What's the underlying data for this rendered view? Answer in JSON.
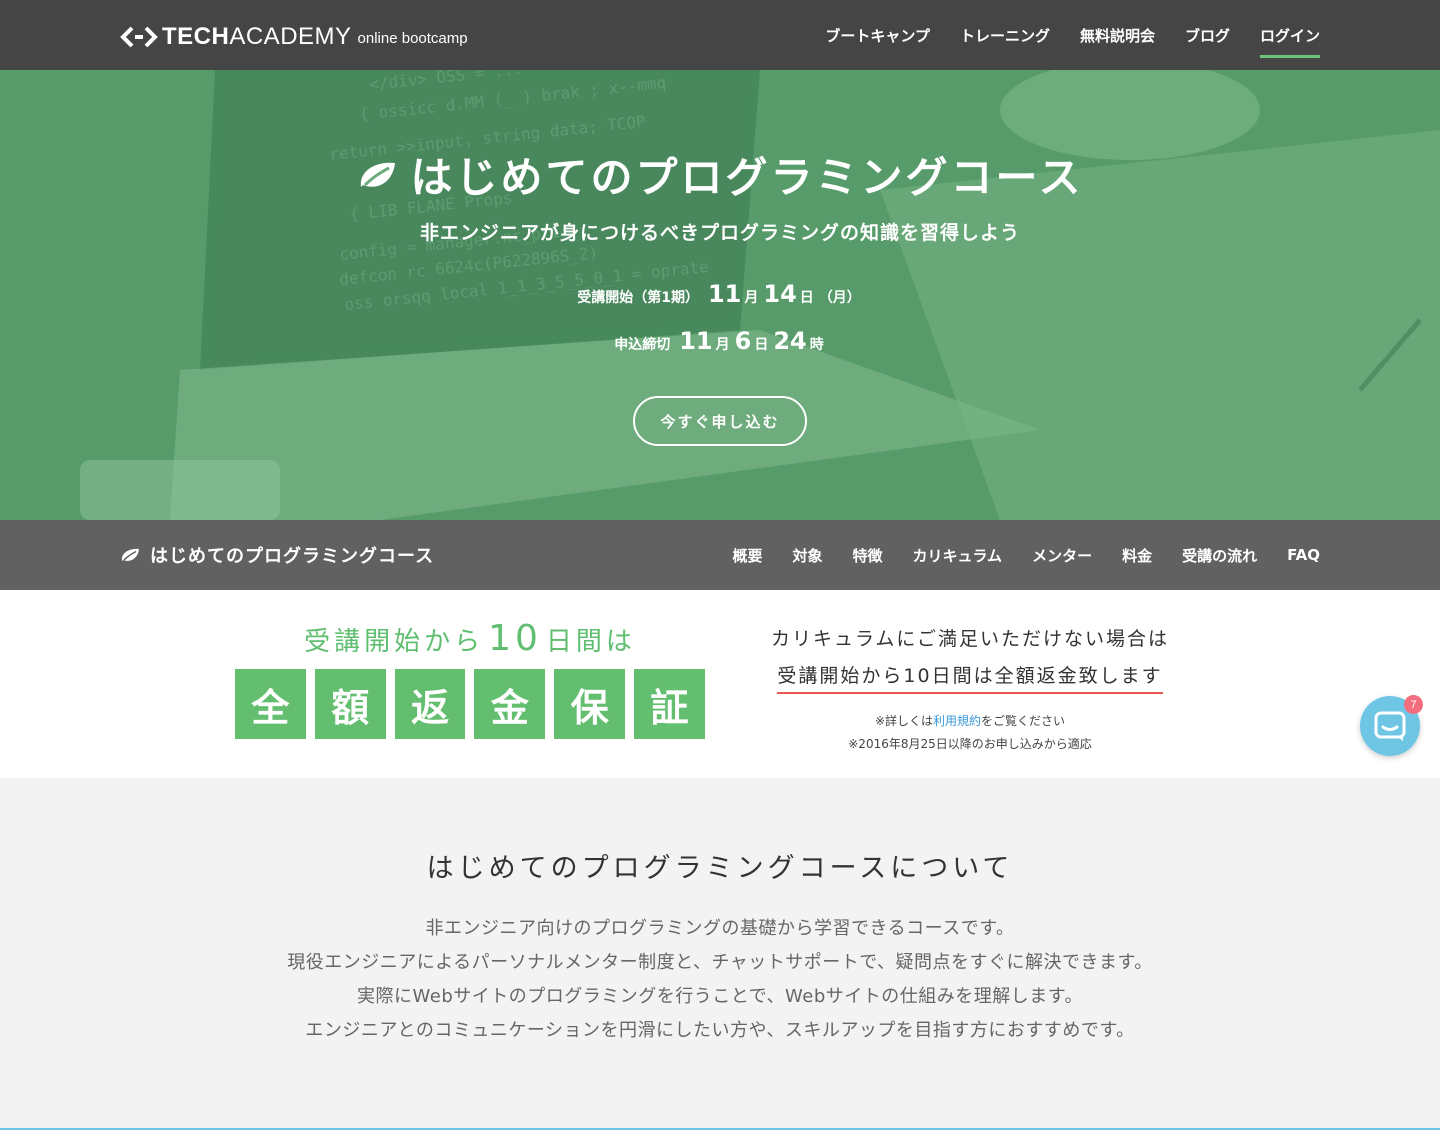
{
  "header": {
    "logo": {
      "tech": "TECH",
      "academy": "ACADEMY",
      "sub": "online bootcamp"
    },
    "nav": [
      {
        "label": "ブートキャンプ"
      },
      {
        "label": "トレーニング"
      },
      {
        "label": "無料説明会"
      },
      {
        "label": "ブログ"
      },
      {
        "label": "ログイン",
        "active": true
      }
    ]
  },
  "hero": {
    "title": "はじめてのプログラミングコース",
    "subtitle": "非エンジニアが身につけるべきプログラミングの知識を習得しよう",
    "start": {
      "label": "受講開始（第1期）",
      "month": "11",
      "month_unit": "月",
      "day": "14",
      "day_unit": "日",
      "weekday": "（月）"
    },
    "deadline": {
      "label": "申込締切",
      "month": "11",
      "month_unit": "月",
      "day": "6",
      "day_unit": "日",
      "hour": "24",
      "hour_unit": "時"
    },
    "cta": "今すぐ申し込む"
  },
  "subnav": {
    "title": "はじめてのプログラミングコース",
    "links": [
      "概要",
      "対象",
      "特徴",
      "カリキュラム",
      "メンター",
      "料金",
      "受講の流れ",
      "FAQ"
    ]
  },
  "guarantee": {
    "headline_pre": "受講開始から",
    "headline_num": "10",
    "headline_post": "日間は",
    "boxes": [
      "全",
      "額",
      "返",
      "金",
      "保",
      "証"
    ],
    "line1": "カリキュラムにご満足いただけない場合は",
    "line2": "受講開始から10日間は全額返金致します",
    "note_pre": "※詳しくは",
    "note_link": "利用規約",
    "note_post": "をご覧ください",
    "note2": "※2016年8月25日以降のお申し込みから適応"
  },
  "chat": {
    "badge": "7"
  },
  "about": {
    "title": "はじめてのプログラミングコースについて",
    "lines": [
      "非エンジニア向けのプログラミングの基礎から学習できるコースです。",
      "現役エンジニアによるパーソナルメンター制度と、チャットサポートで、疑問点をすぐに解決できます。",
      "実際にWebサイトのプログラミングを行うことで、Webサイトの仕組みを理解します。",
      "エンジニアとのコミュニケーションを円滑にしたい方や、スキルアップを目指す方におすすめです。"
    ]
  },
  "colors": {
    "accent_green": "#63be6f",
    "nav_bg": "#454545",
    "subnav_bg": "#616161",
    "underline_red": "#e85a4f",
    "chat_blue": "#6ec6e4"
  }
}
